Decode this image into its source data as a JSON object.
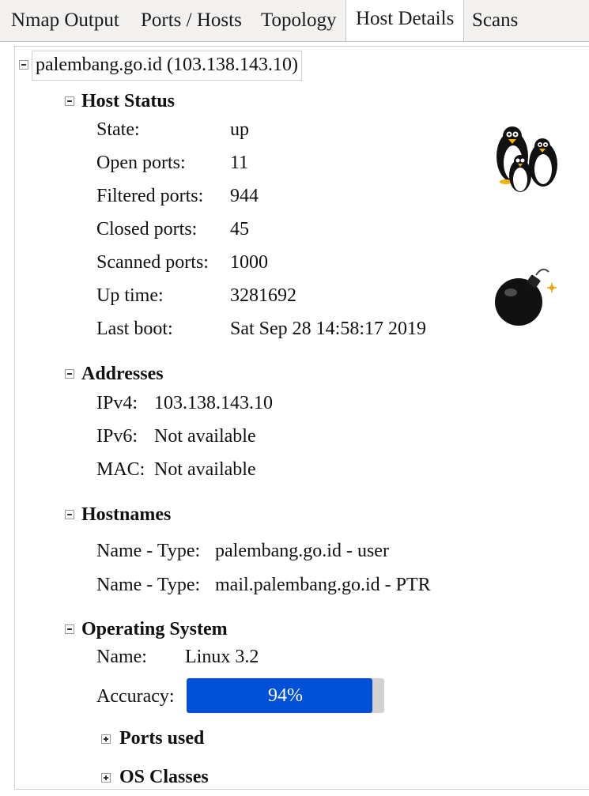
{
  "tabs": [
    {
      "label": "Nmap Output"
    },
    {
      "label": "Ports / Hosts"
    },
    {
      "label": "Topology"
    },
    {
      "label": "Host Details",
      "active": true
    },
    {
      "label": "Scans"
    }
  ],
  "host": {
    "title": "palembang.go.id (103.138.143.10)"
  },
  "host_status": {
    "heading": "Host Status",
    "rows": [
      {
        "label": "State:",
        "value": "up"
      },
      {
        "label": "Open ports:",
        "value": "11"
      },
      {
        "label": "Filtered ports:",
        "value": "944"
      },
      {
        "label": "Closed ports:",
        "value": "45"
      },
      {
        "label": "Scanned ports:",
        "value": "1000"
      },
      {
        "label": "Up time:",
        "value": "3281692"
      },
      {
        "label": "Last boot:",
        "value": "Sat Sep 28 14:58:17 2019"
      }
    ],
    "icons": [
      "penguins-os-icon",
      "bomb-vulnerability-icon"
    ]
  },
  "addresses": {
    "heading": "Addresses",
    "rows": [
      {
        "label": "IPv4:",
        "value": "103.138.143.10"
      },
      {
        "label": "IPv6:",
        "value": "Not available"
      },
      {
        "label": "MAC:",
        "value": "Not available"
      }
    ]
  },
  "hostnames": {
    "heading": "Hostnames",
    "rows": [
      {
        "label": "Name - Type:",
        "value": "palembang.go.id - user"
      },
      {
        "label": "Name - Type:",
        "value": "mail.palembang.go.id - PTR"
      }
    ]
  },
  "os": {
    "heading": "Operating System",
    "name_label": "Name:",
    "name_value": "Linux 3.2",
    "accuracy_label": "Accuracy:",
    "accuracy_text": "94%",
    "accuracy_fraction": 0.94,
    "ports_used": "Ports used",
    "os_classes": "OS Classes"
  },
  "colors": {
    "progress": "#0050d8",
    "progress_track": "#d2d2d2"
  }
}
